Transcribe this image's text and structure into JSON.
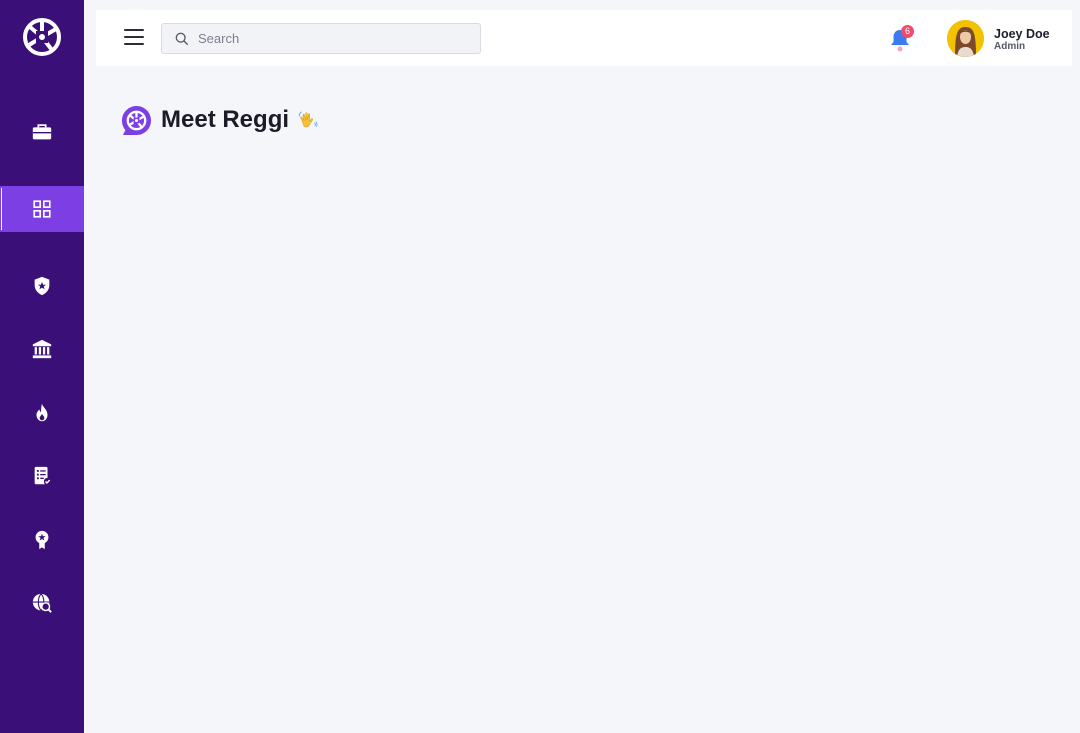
{
  "app": {
    "logo_icon": "reggi-logo-icon",
    "brand_color": "#3a1078",
    "accent_color": "#7b3fe4"
  },
  "sidebar": {
    "items": [
      {
        "icon": "briefcase-icon",
        "active": false
      },
      {
        "icon": "grid-icon",
        "active": true
      },
      {
        "icon": "shield-star-icon",
        "active": false
      },
      {
        "icon": "bank-icon",
        "active": false
      },
      {
        "icon": "flame-icon",
        "active": false
      },
      {
        "icon": "checklist-icon",
        "active": false
      },
      {
        "icon": "award-icon",
        "active": false
      },
      {
        "icon": "globe-search-icon",
        "active": false
      }
    ]
  },
  "header": {
    "menu_icon": "hamburger-icon",
    "search": {
      "placeholder": "Search",
      "value": ""
    },
    "notifications": {
      "icon": "bell-icon",
      "count": "6"
    },
    "user": {
      "name": "Joey Doe",
      "role": "Admin"
    }
  },
  "main": {
    "title": "Meet Reggi",
    "title_emoji_icon": "waving-hand-icon"
  }
}
